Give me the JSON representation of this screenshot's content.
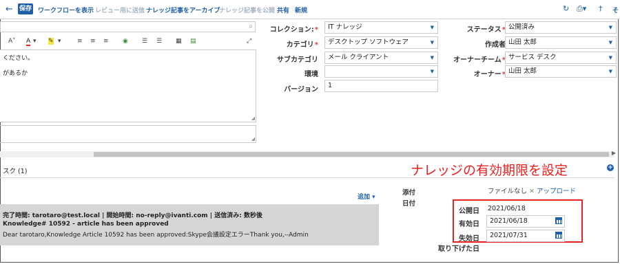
{
  "toolbar": {
    "save": "保存",
    "items": [
      "ワークフローを表示",
      "レビュー用に送信",
      "ナレッジ記事をアーカイブ",
      "ナレッジ記事を公開",
      "共有",
      "新規"
    ],
    "right_text": "そ"
  },
  "editor": {
    "font_size_icon": "A˅",
    "line1": "ください。",
    "line2": "があるか"
  },
  "form": {
    "collection": {
      "label": "コレクション:",
      "value": "IT ナレッジ"
    },
    "category": {
      "label": "カテゴリ",
      "value": "デスクトップ ソフトウェア"
    },
    "subcategory": {
      "label": "サブカテゴリ",
      "value": "メール クライアント"
    },
    "environment": {
      "label": "環境",
      "value": ""
    },
    "version": {
      "label": "バージョン",
      "value": "1"
    },
    "status": {
      "label": "ステータス",
      "value": "公開済み"
    },
    "creator": {
      "label": "作成者",
      "value": "山田 太郎"
    },
    "owner_team": {
      "label": "オーナーチーム",
      "value": "サービス デスク"
    },
    "owner": {
      "label": "オーナー",
      "value": "山田 太郎"
    }
  },
  "tasks": {
    "label": "スク (1)",
    "add": "追加"
  },
  "annotation": "ナレッジの有効期限を設定",
  "email": {
    "line1_prefix": "完了時間: ",
    "line1": "tarotaro@test.local | 開始時間: no-reply@ivanti.com | 送信済み: 数秒後",
    "line2": "Knowledge# 10592 - article has been approved",
    "line3": "Dear tarotaro,Knowledge Article 10592 has been approved:Skype会議設定エラーThank you,--Admin"
  },
  "attachment": {
    "label": "添付",
    "no_file": "ファイルなし",
    "upload": "アップロード"
  },
  "dates": {
    "heading": "日付",
    "published": {
      "label": "公開日",
      "value": "2021/06/18"
    },
    "effective": {
      "label": "有効日",
      "value": "2021/06/18"
    },
    "expiry": {
      "label": "失効日",
      "value": "2021/07/31"
    },
    "withdrawn": {
      "label": "取り下げた日"
    }
  }
}
